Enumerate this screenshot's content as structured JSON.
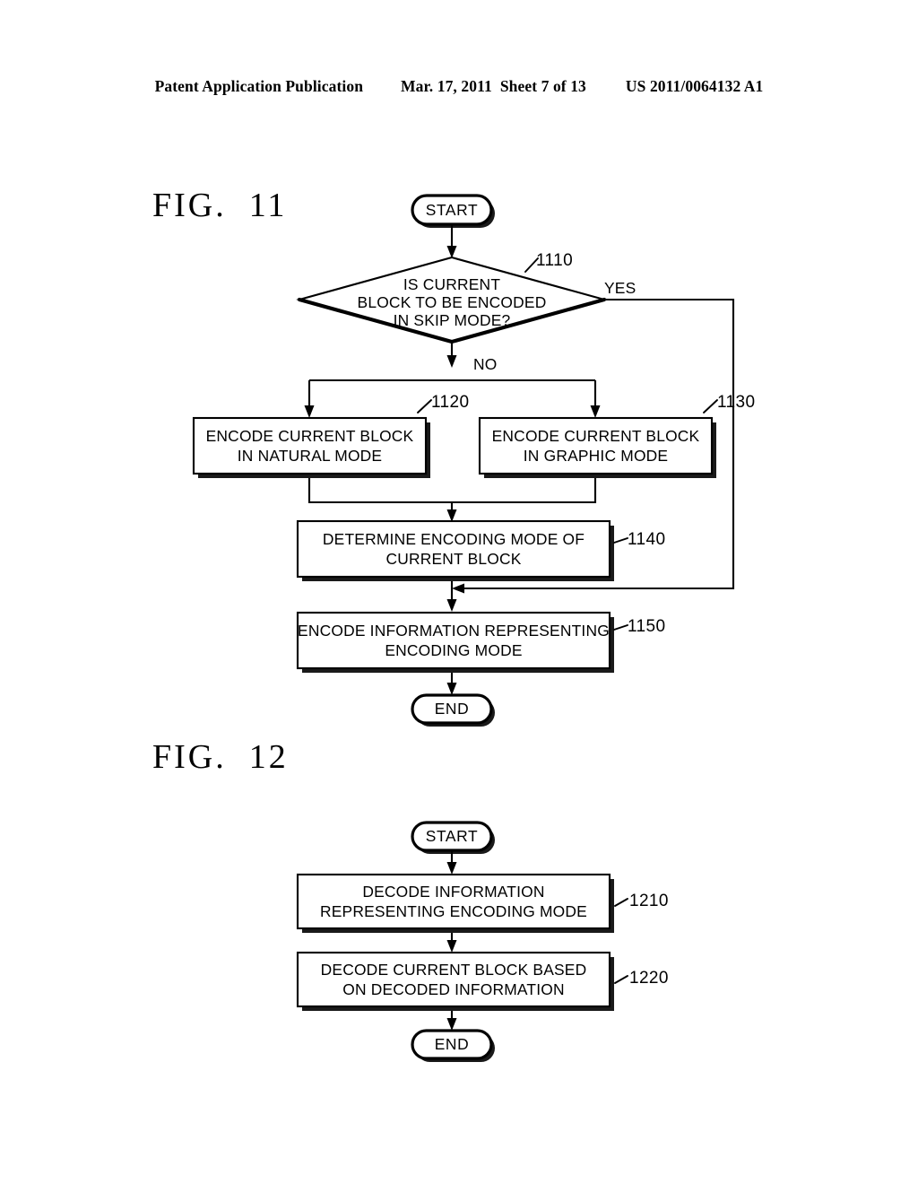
{
  "header": {
    "publication": "Patent Application Publication",
    "date": "Mar. 17, 2011",
    "sheet": "Sheet 7 of 13",
    "publication_number": "US 2011/0064132 A1"
  },
  "figures": [
    {
      "label": "FIG.  11",
      "nodes": {
        "start": "START",
        "decision": {
          "line1": "IS CURRENT",
          "line2": "BLOCK TO BE ENCODED",
          "line3": "IN SKIP MODE?",
          "ref": "1110"
        },
        "natural": {
          "line1": "ENCODE CURRENT BLOCK",
          "line2": "IN NATURAL MODE",
          "ref": "1120"
        },
        "graphic": {
          "line1": "ENCODE CURRENT BLOCK",
          "line2": "IN GRAPHIC MODE",
          "ref": "1130"
        },
        "determine": {
          "line1": "DETERMINE ENCODING MODE OF",
          "line2": "CURRENT BLOCK",
          "ref": "1140"
        },
        "encode_info": {
          "line1": "ENCODE INFORMATION REPRESENTING",
          "line2": "ENCODING MODE",
          "ref": "1150"
        },
        "end": "END"
      },
      "branch_labels": {
        "yes": "YES",
        "no": "NO"
      }
    },
    {
      "label": "FIG.  12",
      "nodes": {
        "start": "START",
        "decode_info": {
          "line1": "DECODE INFORMATION",
          "line2": "REPRESENTING ENCODING MODE",
          "ref": "1210"
        },
        "decode_block": {
          "line1": "DECODE CURRENT BLOCK BASED",
          "line2": "ON DECODED INFORMATION",
          "ref": "1220"
        },
        "end": "END"
      }
    }
  ],
  "colors": {
    "ink": "#000000",
    "paper": "#ffffff",
    "shadow": "#1a1a1a"
  }
}
